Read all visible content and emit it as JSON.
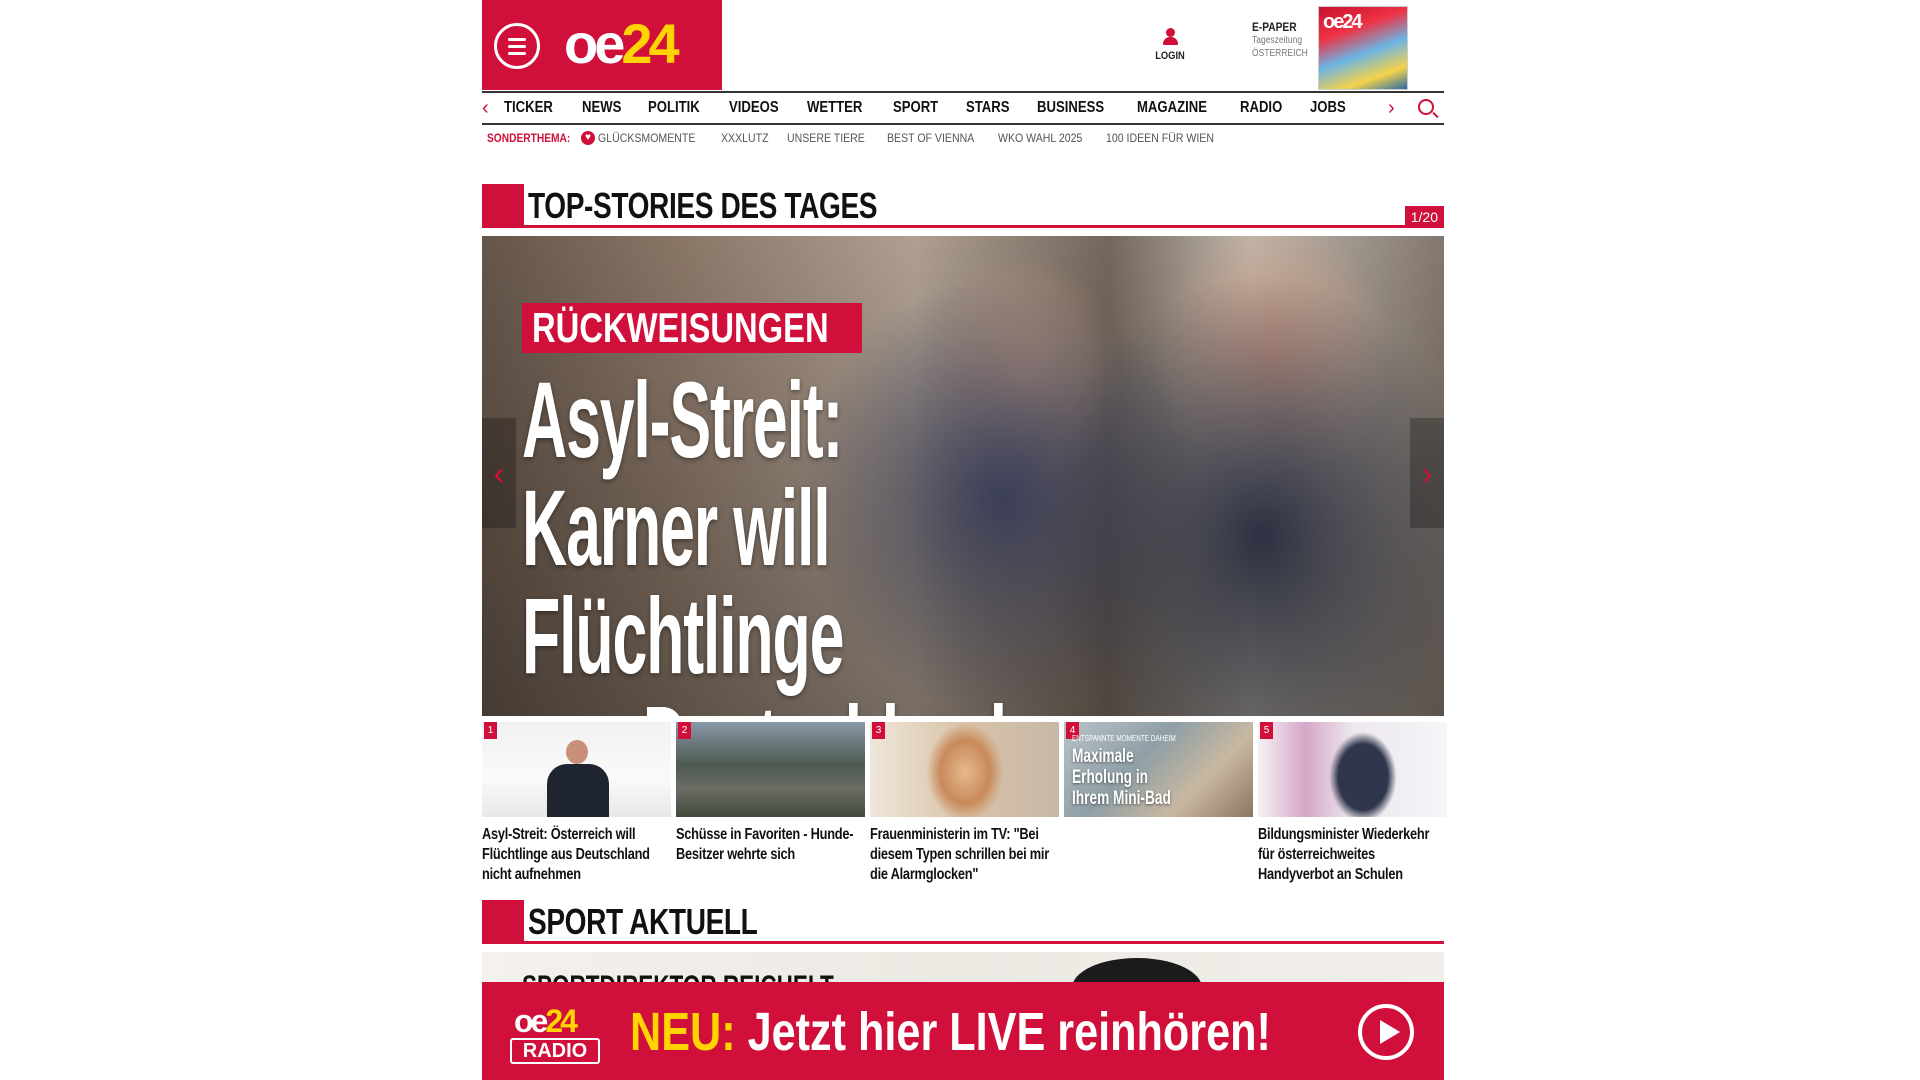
{
  "header": {
    "logo_main": "oe",
    "logo_accent": "24",
    "login_label": "LOGIN",
    "epaper_title": "E-PAPER",
    "epaper_sub1": "Tageszeitung",
    "epaper_sub2": "ÖSTERREICH",
    "epaper_cover_logo": "oe24"
  },
  "nav": {
    "items": [
      "TICKER",
      "NEWS",
      "POLITIK",
      "VIDEOS",
      "WETTER",
      "SPORT",
      "STARS",
      "BUSINESS",
      "MAGAZINE",
      "RADIO",
      "JOBS"
    ]
  },
  "subnav": {
    "label": "SONDERTHEMA:",
    "items": [
      "GLÜCKSMOMENTE",
      "XXXLUTZ",
      "UNSERE TIERE",
      "BEST OF VIENNA",
      "WKO WAHL 2025",
      "100 IDEEN FÜR WIEN"
    ]
  },
  "top_stories": {
    "title": "TOP-STORIES DES TAGES",
    "counter": "1/20",
    "hero": {
      "kicker": "RÜCKWEISUNGEN",
      "headline_lines": [
        "Asyl-Streit:",
        "Karner will Flüchtlinge",
        "aus Deutschland nicht"
      ]
    },
    "teasers": [
      {
        "num": "1",
        "caption": "Asyl-Streit: Österreich will Flüchtlinge aus Deutschland nicht aufnehmen",
        "overlay": "",
        "overlay_kicker": ""
      },
      {
        "num": "2",
        "caption": "Schüsse in Favoriten - Hunde-Besitzer wehrte sich",
        "overlay": "",
        "overlay_kicker": ""
      },
      {
        "num": "3",
        "caption": "Frauenministerin im TV: \"Bei diesem Typen schrillen bei mir die Alarmglocken\"",
        "overlay": "",
        "overlay_kicker": ""
      },
      {
        "num": "4",
        "caption": "",
        "overlay": "Maximale Erholung in Ihrem Mini-Bad",
        "overlay_kicker": "ENTSPANNTE MOMENTE DAHEIM"
      },
      {
        "num": "5",
        "caption": "Bildungsminister Wiederkehr für österreichweites Handyverbot an Schulen",
        "overlay": "",
        "overlay_kicker": ""
      }
    ]
  },
  "sport": {
    "title": "SPORT AKTUELL",
    "teaser_partial": "SPORTDIREKTOR REICHELT"
  },
  "radio_banner": {
    "logo_main": "oe",
    "logo_accent": "24",
    "logo_sub": "RADIO",
    "neu": "NEU:",
    "text": " Jetzt hier LIVE reinhören!"
  },
  "colors": {
    "brand_red": "#d0103a",
    "accent_yellow": "#ffd400"
  }
}
